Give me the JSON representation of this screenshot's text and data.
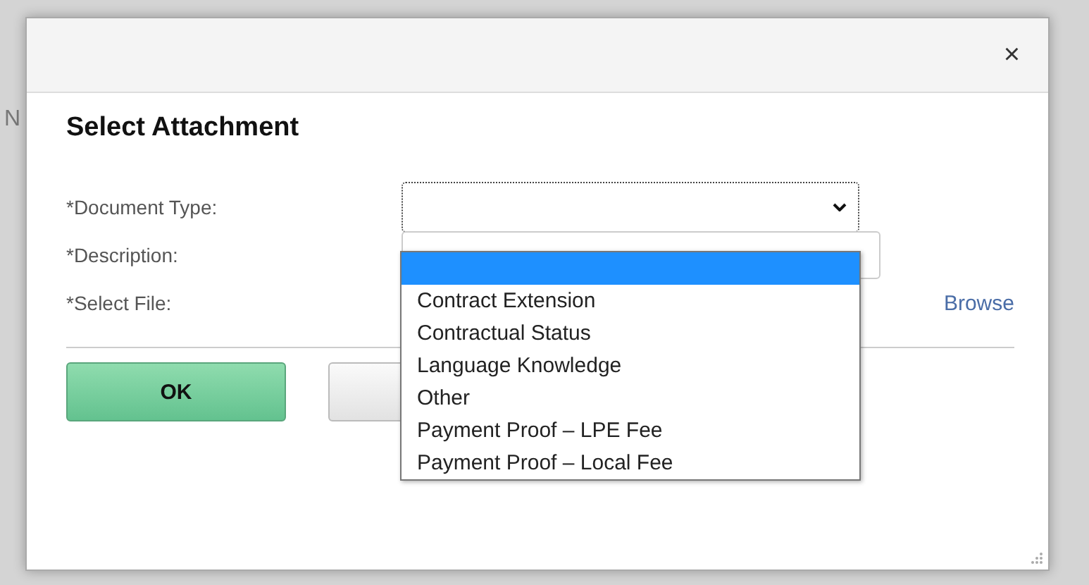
{
  "background_page": {
    "column_header": "N"
  },
  "dialog": {
    "close": "×",
    "title": "Select Attachment",
    "fields": [
      {
        "kind": "select",
        "label": "*Document Type:"
      },
      {
        "kind": "text",
        "label": "*Description:"
      },
      {
        "kind": "file",
        "label": "*Select File:",
        "link": "Browse"
      }
    ],
    "buttons": [
      {
        "kind": "primary",
        "label": "OK"
      },
      {
        "kind": "secondary"
      }
    ],
    "dropdown": {
      "blank_option": {
        "selected": true
      },
      "options": [
        {
          "label": "Contract Extension",
          "selected": false
        },
        {
          "label": "Contractual Status",
          "selected": false
        },
        {
          "label": "Language Knowledge",
          "selected": false
        },
        {
          "label": "Other",
          "selected": false
        },
        {
          "label": "Payment Proof – LPE Fee",
          "selected": false
        },
        {
          "label": "Payment Proof – Local Fee",
          "selected": false
        }
      ]
    }
  }
}
